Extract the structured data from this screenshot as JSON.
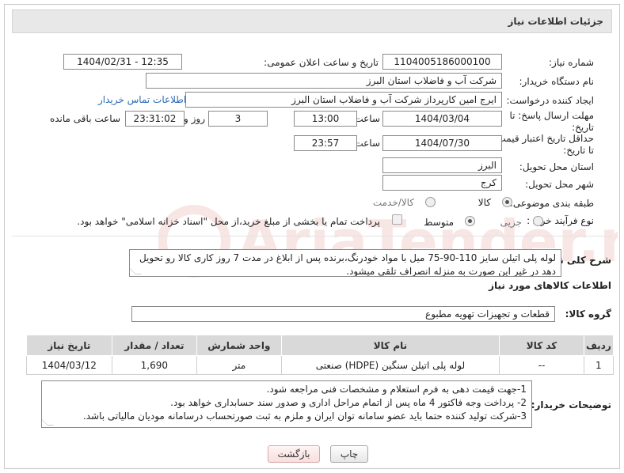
{
  "header": {
    "title": "جزئیات اطلاعات نیاز"
  },
  "labels": {
    "need_number": "شماره نیاز:",
    "announce_datetime": "تاریخ و ساعت اعلان عمومی:",
    "buyer_org": "نام دستگاه خریدار:",
    "requester": "ایجاد کننده درخواست:",
    "reply_deadline": "مهلت ارسال پاسخ: تا تاریخ:",
    "time": "ساعت",
    "day_and": "روز و",
    "remaining": "ساعت باقی مانده",
    "price_validity": "حداقل تاریخ اعتبار قیمت: تا تاریخ:",
    "time2": "ساعت",
    "province": "استان محل تحویل:",
    "city": "شهر محل تحویل:",
    "category": "طبقه بندی موضوعی:",
    "purchase_type": "نوع فرآیند خرید :",
    "description": "شرح کلی نیاز:",
    "goods_info": "اطلاعات کالاهای مورد نیاز",
    "goods_group": "گروه کالا:",
    "buyer_notes": "توضیحات خریدار:"
  },
  "fields": {
    "need_number": "1104005186000100",
    "announce_datetime": "1404/02/31 - 12:35",
    "buyer_org": "شرکت آب و فاضلاب استان البرز",
    "requester": "ایرج امین کارپرداز شرکت آب و فاضلاب استان البرز",
    "contact_link": "اطلاعات تماس خریدار",
    "reply_date": "1404/03/04",
    "reply_time": "13:00",
    "days": "3",
    "remaining_time": "23:31:02",
    "validity_date": "1404/07/30",
    "validity_time": "23:57",
    "province": "البرز",
    "city": "کرج"
  },
  "category_options": [
    {
      "label": "کالا",
      "checked": true
    },
    {
      "label": "کالا/خدمت",
      "checked": false
    }
  ],
  "purchase_options": [
    {
      "label": "جزیی",
      "checked": false
    },
    {
      "label": "متوسط",
      "checked": true
    }
  ],
  "payment_note": "پرداخت تمام یا بخشی از مبلغ خرید،از محل \"اسناد خزانه اسلامی\" خواهد بود.",
  "description": "لوله پلی اتیلن سایز 110-90-75 میل با مواد خودرنگ،برنده پس از ابلاغ در مدت 7 روز کاری کالا رو تحویل دهد در غیر این صورت به منزله انصراف تلقی میشود.",
  "goods_group": "قطعات و تجهیزات تهویه مطبوع",
  "table": {
    "headers": [
      "ردیف",
      "کد کالا",
      "نام کالا",
      "واحد شمارش",
      "تعداد / مقدار",
      "تاریخ نیاز"
    ],
    "rows": [
      [
        "1",
        "--",
        "لوله پلی اتیلن سنگین (HDPE) صنعتی",
        "متر",
        "1,690",
        "1404/03/12"
      ]
    ]
  },
  "buyer_notes": [
    "1-جهت قیمت دهی به فرم استعلام و مشخصات فنی مراجعه شود.",
    "2- پرداخت وجه فاکتور 4 ماه پس از اتمام مراحل اداری و صدور سند حسابداری خواهد بود.",
    "3-شرکت تولید کننده حتما باید عضو سامانه توان ایران و ملزم به ثبت صورتحساب درسامانه مودیان مالیاتی باشد."
  ],
  "buttons": {
    "print": "چاپ",
    "back": "بازگشت"
  },
  "watermark": "AriaTender.neT",
  "colors": {
    "link": "#2a6ab7",
    "header_bg": "#e8e8e8",
    "table_header_bg": "#d9d9d9",
    "watermark": "#c0392b"
  }
}
